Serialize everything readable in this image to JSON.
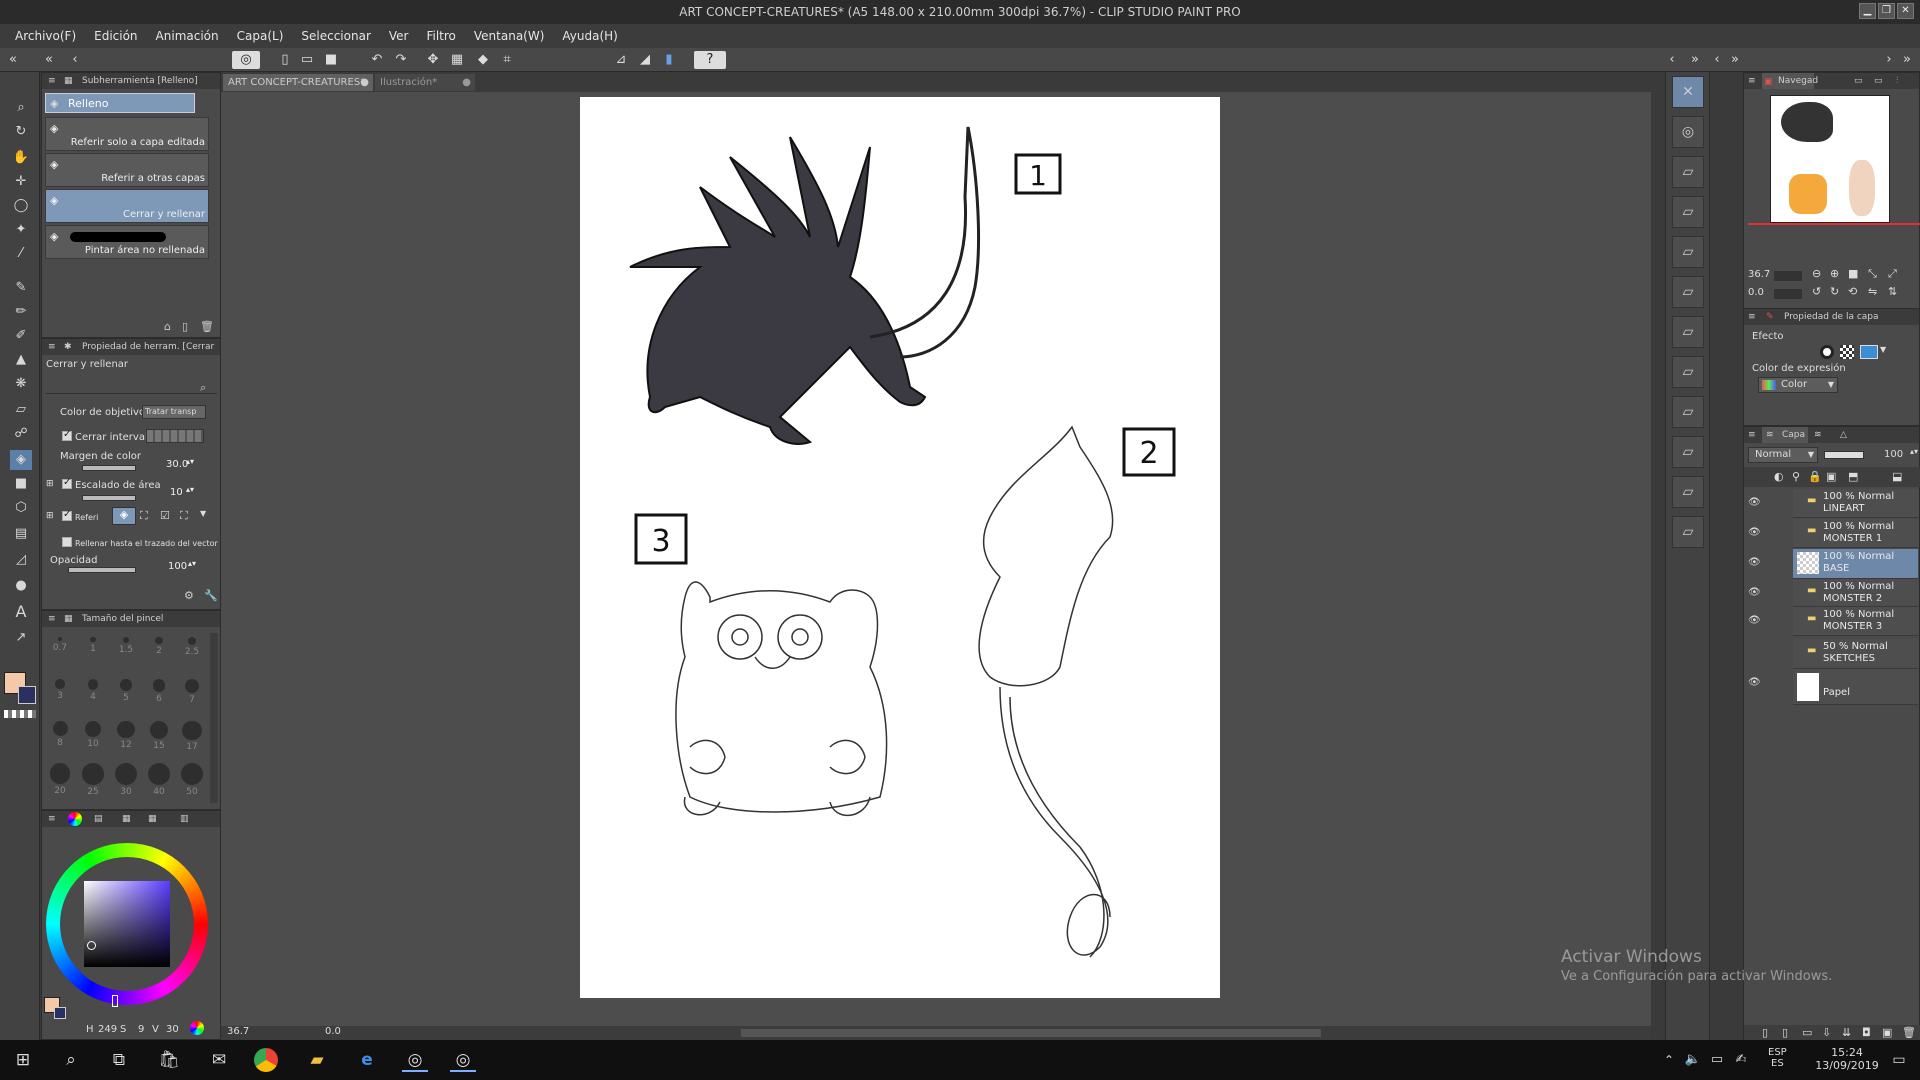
{
  "window": {
    "title": "ART CONCEPT-CREATURES* (A5 148.00 x 210.00mm 300dpi 36.7%) - CLIP STUDIO PAINT PRO"
  },
  "menu": [
    "Archivo(F)",
    "Edición",
    "Animación",
    "Capa(L)",
    "Seleccionar",
    "Ver",
    "Filtro",
    "Ventana(W)",
    "Ayuda(H)"
  ],
  "subtool": {
    "header": "Subherramienta [Relleno]",
    "group": "Relleno",
    "items": [
      "Referir solo a capa editada",
      "Referir a otras capas",
      "Cerrar y rellenar",
      "Pintar área no rellenada"
    ]
  },
  "toolprop": {
    "header": "Propiedad de herram. [Cerrar",
    "name": "Cerrar y rellenar",
    "target_label": "Color de objetivo",
    "target_value": "Tratar transp",
    "close_gap": "Cerrar intervalo",
    "color_margin": "Margen de color",
    "color_margin_value": "30.0",
    "area_scaling": "Escalado de área",
    "area_scaling_value": "10",
    "refer": "Referi",
    "fill_vector": "Rellenar hasta el trazado del vector",
    "opacity": "Opacidad",
    "opacity_value": "100"
  },
  "brushsize": {
    "header": "Tamaño del pincel",
    "sizes": [
      "0.7",
      "1",
      "1.5",
      "2",
      "2.5",
      "3",
      "4",
      "5",
      "6",
      "7",
      "8",
      "10",
      "12",
      "15",
      "17",
      "20",
      "25",
      "30",
      "40",
      "50"
    ]
  },
  "colorwheel": {
    "h_value": "249",
    "s_value": "9",
    "v_value": "30",
    "main_color": "#f5c9a8"
  },
  "tabs": [
    "ART CONCEPT-CREATURES*",
    "Ilustración*"
  ],
  "canvas": {
    "label1": "1",
    "label2": "2",
    "label3": "3"
  },
  "status": {
    "zoom": "36.7",
    "angle": "0.0"
  },
  "navigator": {
    "header": "Navegad",
    "zoom": "36.7",
    "angle": "0.0"
  },
  "layerprop": {
    "header": "Propiedad de la capa",
    "effect": "Efecto",
    "expr_label": "Color de expresión",
    "expr_value": "Color"
  },
  "layers": {
    "header": "Capa",
    "blend": "Normal",
    "opacity": "100",
    "items": [
      {
        "line1": "100 % Normal",
        "line2": "LINEART"
      },
      {
        "line1": "100 % Normal",
        "line2": "MONSTER 1"
      },
      {
        "line1": "100 % Normal",
        "line2": "BASE"
      },
      {
        "line1": "100 % Normal",
        "line2": "MONSTER 2"
      },
      {
        "line1": "100 % Normal",
        "line2": "MONSTER 3"
      },
      {
        "line1": "50 % Normal",
        "line2": "SKETCHES"
      },
      {
        "line1": "",
        "line2": "Papel"
      }
    ]
  },
  "watermark": {
    "line1": "Activar Windows",
    "line2": "Ve a Configuración para activar Windows."
  },
  "taskbar": {
    "lang1": "ESP",
    "lang2": "ES",
    "time": "15:24",
    "date": "13/09/2019"
  }
}
